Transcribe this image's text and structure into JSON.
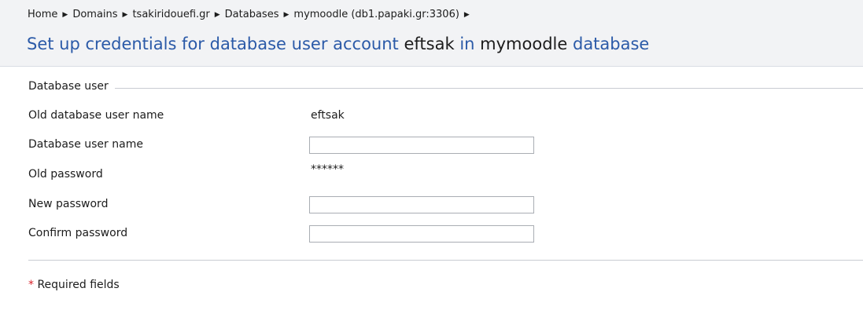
{
  "breadcrumb": [
    {
      "label": "Home"
    },
    {
      "label": "Domains"
    },
    {
      "label": "tsakiridouefi.gr"
    },
    {
      "label": "Databases"
    },
    {
      "label": "mymoodle (db1.papaki.gr:3306)"
    }
  ],
  "separator_glyph": "▶",
  "title": {
    "prefix": "Set up credentials for database user account",
    "user": "eftsak",
    "middle": "in",
    "database": "mymoodle",
    "suffix": "database"
  },
  "form": {
    "legend": "Database user",
    "old_user_label": "Old database user name",
    "old_user_value": "eftsak",
    "user_name_label": "Database user name",
    "user_name_value": "",
    "old_password_label": "Old password",
    "old_password_value": "******",
    "new_password_label": "New password",
    "new_password_value": "",
    "confirm_password_label": "Confirm password",
    "confirm_password_value": ""
  },
  "required_note": {
    "star": "*",
    "text": "Required fields"
  },
  "colors": {
    "title_blue": "#2b5aa8",
    "required_red": "#d9222a",
    "header_bg": "#f2f3f5"
  }
}
